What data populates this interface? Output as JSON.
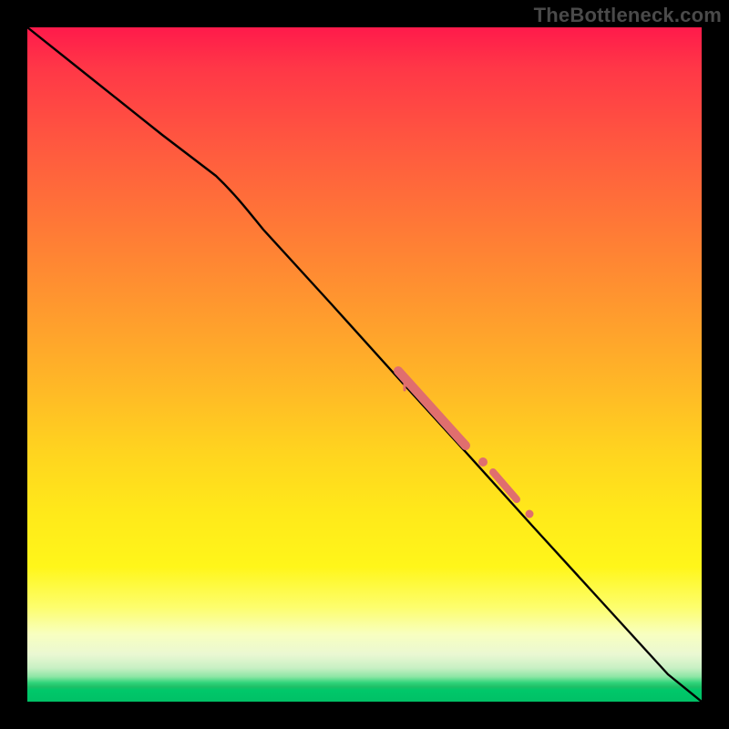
{
  "watermark": "TheBottleneck.com",
  "chart_data": {
    "type": "line",
    "title": "",
    "xlabel": "",
    "ylabel": "",
    "xlim": [
      0,
      100
    ],
    "ylim": [
      0,
      100
    ],
    "grid": false,
    "legend": false,
    "series": [
      {
        "name": "curve",
        "color": "#000000",
        "x": [
          0,
          10,
          20,
          28,
          35,
          45,
          55,
          65,
          75,
          85,
          95,
          100
        ],
        "values": [
          100,
          92,
          84,
          78,
          70,
          59,
          48,
          37,
          26,
          15,
          4,
          0
        ]
      }
    ],
    "highlights": [
      {
        "name": "segment-a",
        "color": "#e06e6e",
        "width": 7,
        "x0": 55,
        "y0": 49,
        "x1": 65,
        "y1": 38
      },
      {
        "name": "dot-1",
        "color": "#e06e6e",
        "r": 4.5,
        "x": 67.5,
        "y": 35.5
      },
      {
        "name": "segment-b",
        "color": "#e06e6e",
        "width": 6,
        "x0": 69,
        "y0": 34,
        "x1": 72.5,
        "y1": 30
      },
      {
        "name": "dot-2",
        "color": "#e06e6e",
        "r": 4,
        "x": 74.5,
        "y": 27.8
      }
    ],
    "background_gradient_stops": [
      {
        "pos": 0.0,
        "color": "#ff1a4b"
      },
      {
        "pos": 0.3,
        "color": "#ff7a36"
      },
      {
        "pos": 0.63,
        "color": "#ffd41f"
      },
      {
        "pos": 0.8,
        "color": "#fff61a"
      },
      {
        "pos": 0.92,
        "color": "#f5fbe0"
      },
      {
        "pos": 0.975,
        "color": "#2fd47a"
      },
      {
        "pos": 1.0,
        "color": "#00c066"
      }
    ]
  }
}
